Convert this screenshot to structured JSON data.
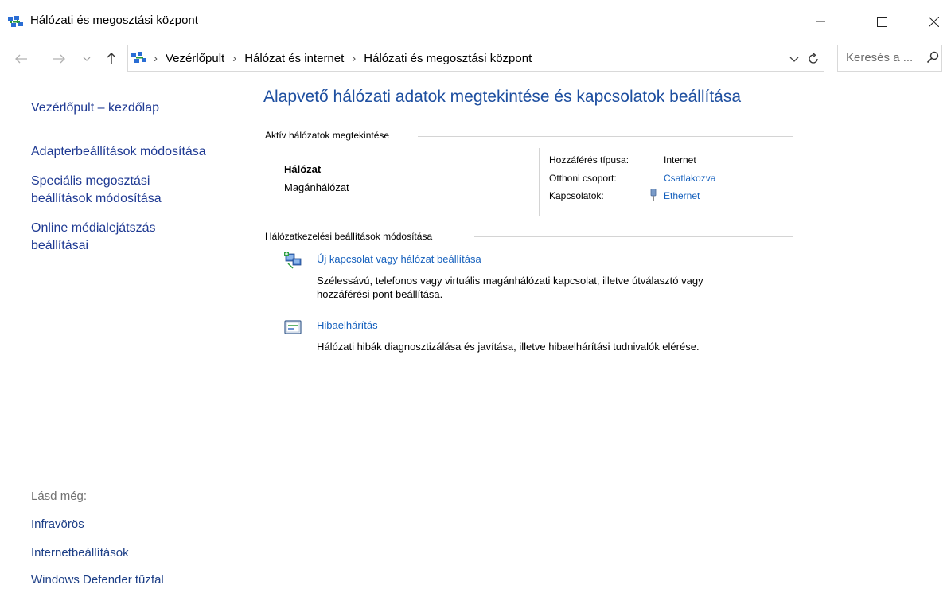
{
  "window": {
    "title": "Hálózati és megosztási központ"
  },
  "address": {
    "crumbs": [
      "Vezérlőpult",
      "Hálózat és internet",
      "Hálózati és megosztási központ"
    ],
    "search_placeholder": "Keresés a ..."
  },
  "left_pane": {
    "home": "Vezérlőpult – kezdőlap",
    "adapter": "Adapterbeállítások módosítása",
    "sharing_line1": "Speciális megosztási",
    "sharing_line2": "beállítások módosítása",
    "media_line1": "Online médialejátszás",
    "media_line2": "beállításai",
    "see_also": "Lásd még:",
    "see_also_links": [
      "Infravörös",
      "Internetbeállítások",
      "Windows Defender tűzfal"
    ]
  },
  "main": {
    "title": "Alapvető hálózati adatok megtekintése és kapcsolatok beállítása",
    "active_networks_label": "Aktív hálózatok megtekintése",
    "network": {
      "name": "Hálózat",
      "type": "Magánhálózat",
      "access_type_label": "Hozzáférés típusa:",
      "access_type_value": "Internet",
      "homegroup_label": "Otthoni csoport:",
      "homegroup_value": "Csatlakozva",
      "connections_label": "Kapcsolatok:",
      "connections_value": "Ethernet"
    },
    "change_settings_label": "Hálózatkezelési beállítások módosítása",
    "tasks": [
      {
        "title": "Új kapcsolat vagy hálózat beállítása",
        "desc_line1": "Szélessávú, telefonos vagy virtuális magánhálózati kapcsolat, illetve útválasztó vagy",
        "desc_line2": "hozzáférési pont beállítása."
      },
      {
        "title": "Hibaelhárítás",
        "desc_line1": "Hálózati hibák diagnosztizálása és javítása, illetve hibaelhárítási tudnivalók elérése."
      }
    ]
  },
  "colors": {
    "link": "#1560bd",
    "heading": "#1e4fa0"
  }
}
